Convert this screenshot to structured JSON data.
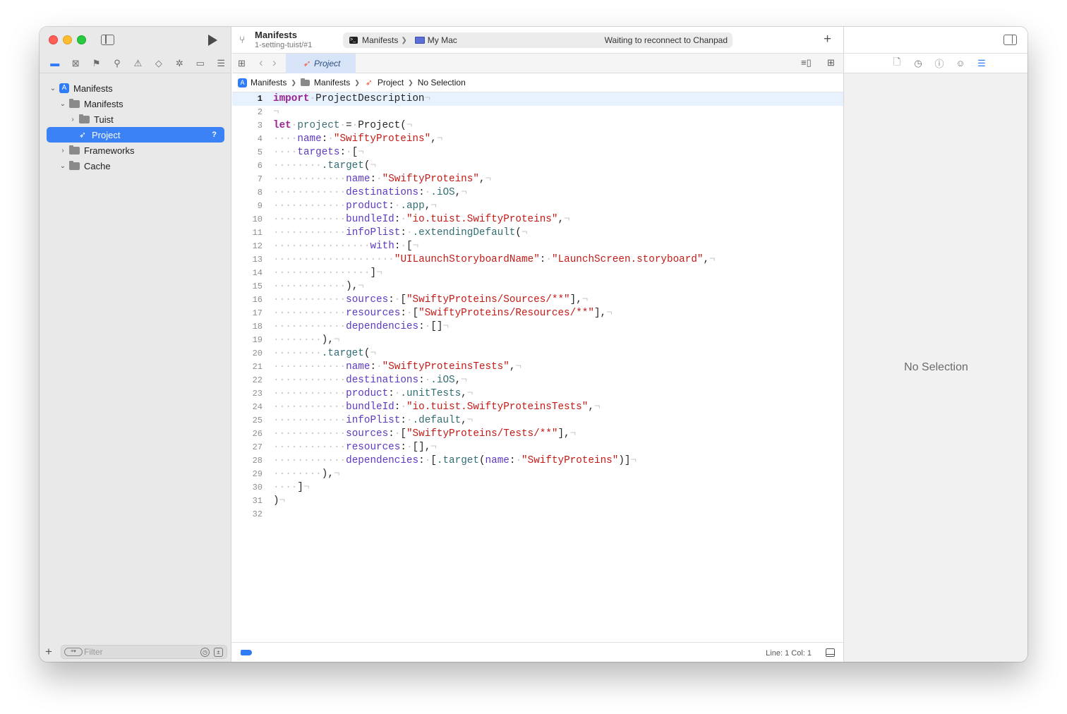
{
  "sidebar": {
    "tree": [
      {
        "label": "Manifests",
        "icon": "xcode-project-icon",
        "expanded": true,
        "level": 0
      },
      {
        "label": "Manifests",
        "icon": "folder-icon",
        "expanded": true,
        "level": 1
      },
      {
        "label": "Tuist",
        "icon": "folder-icon",
        "expanded": false,
        "level": 2
      },
      {
        "label": "Project",
        "icon": "swift-file-icon",
        "level": 2,
        "selected": true,
        "badge": "?"
      },
      {
        "label": "Frameworks",
        "icon": "folder-icon",
        "expanded": false,
        "level": 1
      },
      {
        "label": "Cache",
        "icon": "folder-icon",
        "expanded": true,
        "level": 1
      }
    ],
    "filter_placeholder": "Filter"
  },
  "toolbar": {
    "scheme_title": "Manifests",
    "scheme_branch": "1-setting-tuist/#1",
    "activity_scheme": "Manifests",
    "activity_destination": "My Mac",
    "activity_status": "Waiting to reconnect to Chanpad"
  },
  "tabbar": {
    "tab_label": "Project"
  },
  "jumpbar": {
    "items": [
      "Manifests",
      "Manifests",
      "Project",
      "No Selection"
    ]
  },
  "editor": {
    "current_line": 1,
    "lines": [
      "import ProjectDescription",
      "",
      "let project = Project(",
      "    name: \"SwiftyProteins\",",
      "    targets: [",
      "        .target(",
      "            name: \"SwiftyProteins\",",
      "            destinations: .iOS,",
      "            product: .app,",
      "            bundleId: \"io.tuist.SwiftyProteins\",",
      "            infoPlist: .extendingDefault(",
      "                with: [",
      "                    \"UILaunchStoryboardName\": \"LaunchScreen.storyboard\",",
      "                ]",
      "            ),",
      "            sources: [\"SwiftyProteins/Sources/**\"],",
      "            resources: [\"SwiftyProteins/Resources/**\"],",
      "            dependencies: []",
      "        ),",
      "        .target(",
      "            name: \"SwiftyProteinsTests\",",
      "            destinations: .iOS,",
      "            product: .unitTests,",
      "            bundleId: \"io.tuist.SwiftyProteinsTests\",",
      "            infoPlist: .default,",
      "            sources: [\"SwiftyProteins/Tests/**\"],",
      "            resources: [],",
      "            dependencies: [.target(name: \"SwiftyProteins\")]",
      "        ),",
      "    ]",
      ")",
      ""
    ]
  },
  "statusbar": {
    "line_col": "Line: 1  Col: 1"
  },
  "inspector": {
    "empty_text": "No Selection"
  },
  "colors": {
    "accent": "#2f7cf6",
    "keyword": "#9b2393",
    "string": "#c41a16",
    "property": "#5d3ac2"
  }
}
